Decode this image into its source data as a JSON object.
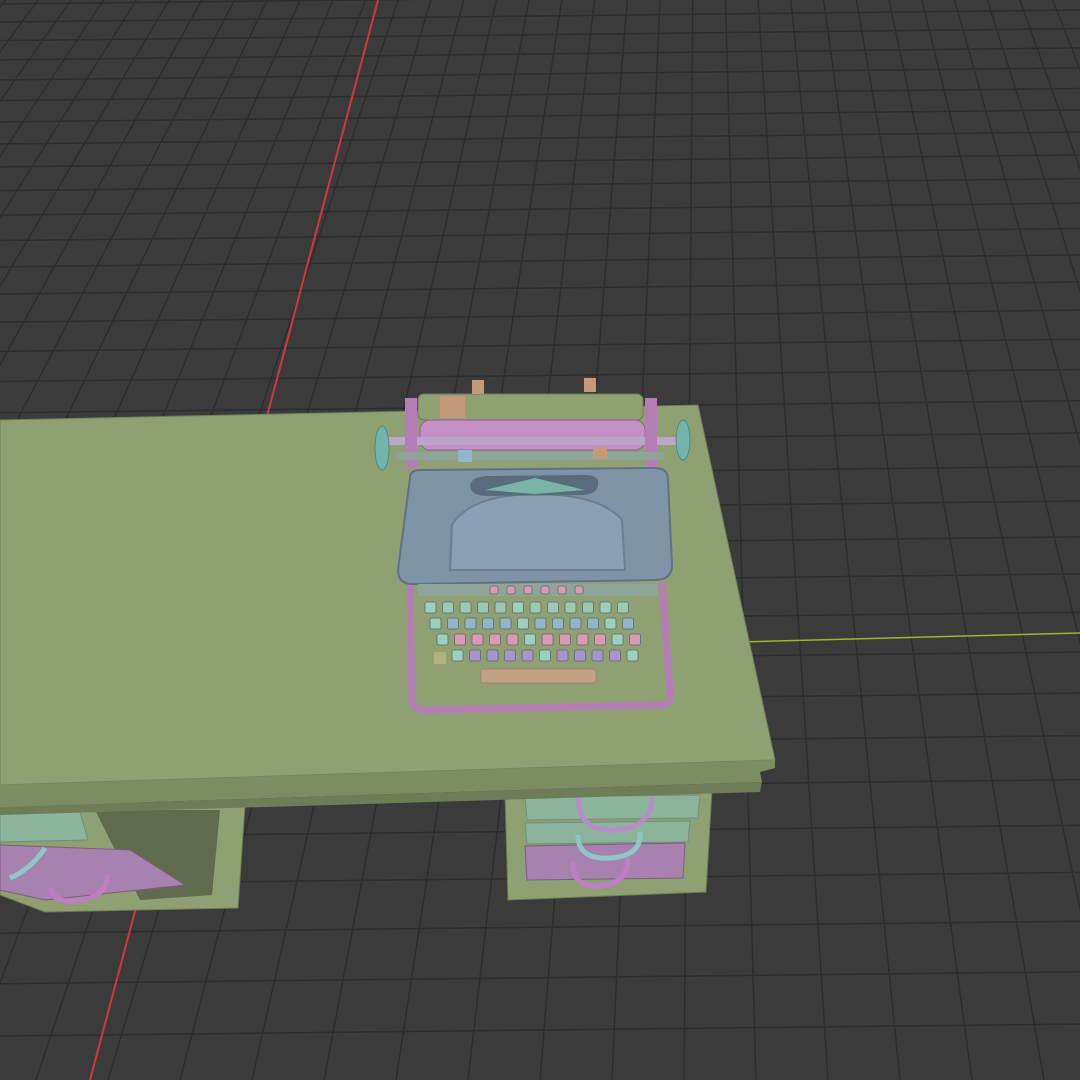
{
  "viewport": {
    "background": "#3b3b3b",
    "grid_color": "#2c2c2c",
    "x_axis_color": "#9fb52a",
    "y_axis_color": "#d2383f"
  },
  "scene_objects": {
    "desk": {
      "color": "#8fa072"
    },
    "drawer_colors": [
      "#8cb49a",
      "#a882ae"
    ],
    "typewriter": {
      "body_color": "#7f93a7",
      "frame_color": "#b47db6",
      "platen_color": "#c58fc7",
      "knob_color": "#74b4ab",
      "key_colors": [
        "#9bc9b5",
        "#8fb7c9",
        "#d99ab3",
        "#a894cf",
        "#9ad0bf"
      ]
    }
  }
}
